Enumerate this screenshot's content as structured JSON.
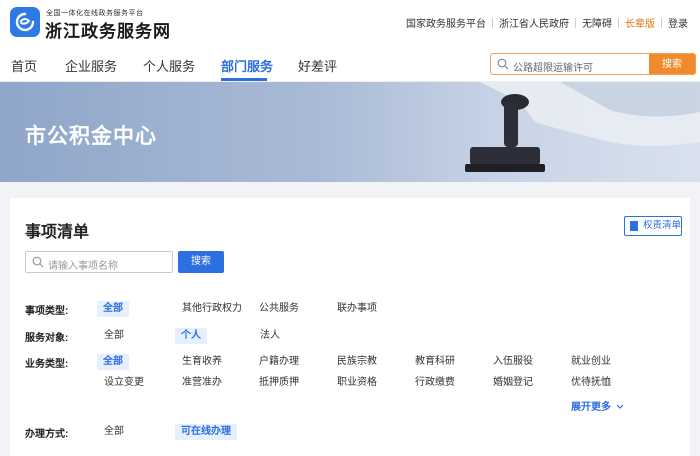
{
  "header": {
    "brand_sub": "全国一体化在线政务服务平台",
    "brand_main": "浙江政务服务网",
    "links": [
      "国家政务服务平台",
      "浙江省人民政府",
      "无障碍",
      "长辈版",
      "登录"
    ]
  },
  "nav": {
    "items": [
      "首页",
      "企业服务",
      "个人服务",
      "部门服务",
      "好差评"
    ],
    "active": "部门服务"
  },
  "top_search": {
    "placeholder": "公路超限运输许可",
    "button": "搜索",
    "icon": "search-icon"
  },
  "banner": {
    "title": "市公积金中心"
  },
  "card": {
    "title": "事项清单",
    "rights_button": "权责清单",
    "search_placeholder": "请输入事项名称",
    "search_button": "搜索"
  },
  "filters": {
    "type_label": "事项类型:",
    "type_options": [
      "全部",
      "其他行政权力",
      "公共服务",
      "联办事项"
    ],
    "target_label": "服务对象:",
    "target_options": [
      "全部",
      "个人",
      "法人"
    ],
    "business_label": "业务类型:",
    "business_row1": [
      "全部",
      "生育收养",
      "户籍办理",
      "民族宗教",
      "教育科研",
      "入伍服役",
      "就业创业"
    ],
    "business_row2": [
      "设立变更",
      "准营准办",
      "抵押质押",
      "职业资格",
      "行政缴费",
      "婚姻登记",
      "优待抚恤"
    ],
    "expand_more": "展开更多",
    "method_label": "办理方式:",
    "method_options": [
      "全部",
      "可在线办理"
    ]
  },
  "colors": {
    "primary": "#2c6fe0",
    "accent_orange": "#f08a2c",
    "elder_orange": "#e2720e"
  }
}
